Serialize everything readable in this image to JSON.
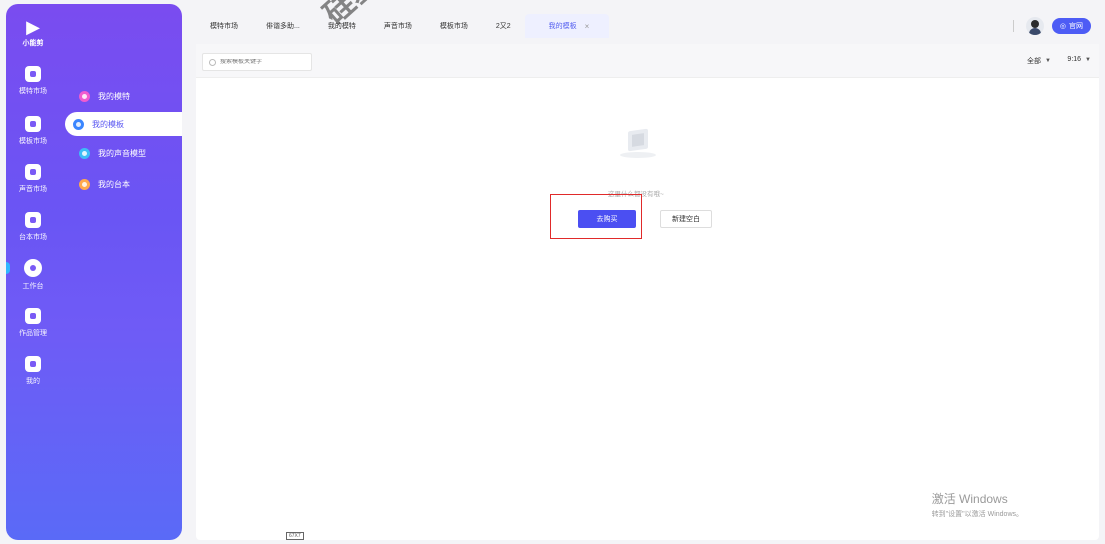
{
  "app": {
    "logo_name": "小能剪"
  },
  "icon_rail": [
    {
      "label": "模特市场",
      "icon": "person-icon"
    },
    {
      "label": "模板市场",
      "icon": "template-icon"
    },
    {
      "label": "声音市场",
      "icon": "mic-icon"
    },
    {
      "label": "台本市场",
      "icon": "script-icon"
    },
    {
      "label": "工作台",
      "icon": "workbench-icon",
      "active": true
    },
    {
      "label": "作品管理",
      "icon": "bookmark-icon"
    },
    {
      "label": "我的",
      "icon": "user-icon"
    }
  ],
  "submenu": [
    {
      "label": "我的模特",
      "color": "#f05bd0"
    },
    {
      "label": "我的模板",
      "color": "#3a86ff",
      "active": true
    },
    {
      "label": "我的声音模型",
      "color": "#3dbdf7"
    },
    {
      "label": "我的台本",
      "color": "#ffa94d"
    }
  ],
  "tabs": [
    {
      "label": "模特市场"
    },
    {
      "label": "俳谐多助..."
    },
    {
      "label": "我的模特"
    },
    {
      "label": "声音市场"
    },
    {
      "label": "模板市场"
    },
    {
      "label": "2又2"
    },
    {
      "label": "我的模板",
      "active": true,
      "close": "×"
    }
  ],
  "header": {
    "official_label": "官网"
  },
  "search": {
    "placeholder": "搜索模板关键字"
  },
  "filters": {
    "scope": "全部",
    "ratio": "9:16"
  },
  "empty_state": {
    "message": "这里什么都没有哦~",
    "buy_label": "去购买",
    "new_label": "新建空白"
  },
  "windows_watermark": {
    "line1": "激活 Windows",
    "line2": "转到\"设置\"以激活 Windows。"
  },
  "bottom_tag": "67X7",
  "stamp_text": "硅基原"
}
